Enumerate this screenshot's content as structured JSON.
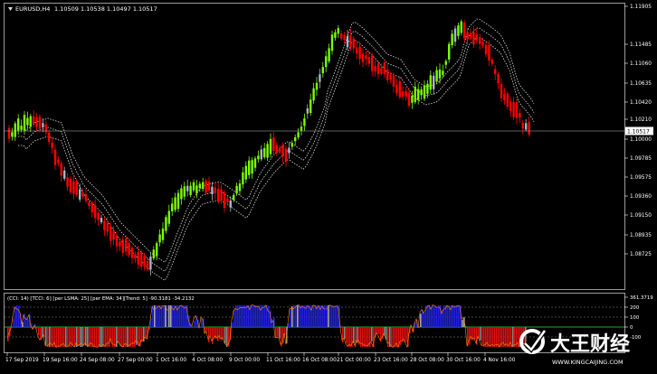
{
  "chart_header": {
    "symbol_info": "EURUSD,H4",
    "ohlc": "1.10509 1.10538 1.10497 1.10517"
  },
  "price_axis": {
    "ticks": [
      "1.11905",
      "1.11485",
      "1.11060",
      "1.10635",
      "1.10420",
      "1.10210",
      "1.10000",
      "1.09785",
      "1.09575",
      "1.09360",
      "1.09150",
      "1.08935",
      "1.08725"
    ],
    "current_price": "1.10517"
  },
  "time_axis": {
    "labels": [
      "17 Sep 2019",
      "19 Sep 16:00",
      "24 Sep 08:00",
      "27 Sep 00:00",
      "1 Oct 16:00",
      "4 Oct 08:00",
      "9 Oct 00:00",
      "11 Oct 16:00",
      "16 Oct 08:00",
      "21 Oct 00:00",
      "23 Oct 16:00",
      "28 Oct 08:00",
      "30 Oct 16:00",
      "4 Nov 16:00"
    ]
  },
  "indicator": {
    "label": "(CCI: 14) [TCCI: 6] [per LSMA: 25] [per EMA: 34][Trend: 5] -90.3181 -34.2132",
    "axis_ticks": [
      "361.3719",
      "200",
      "100",
      "0",
      "-100"
    ]
  },
  "watermark": {
    "brand": "大王财经",
    "url": "WWW.KINGCAIJING.COM"
  },
  "colors": {
    "background": "#000000",
    "bull_candle": "#7cfc00",
    "bear_candle": "#ff0000",
    "neutral_candle": "#a8b4c8",
    "bands": "#dddddd",
    "cci_positive": "#2222dd",
    "cci_negative": "#dd1111",
    "cci_line": "#ff8800",
    "cci_zero": "#22aa22"
  }
}
